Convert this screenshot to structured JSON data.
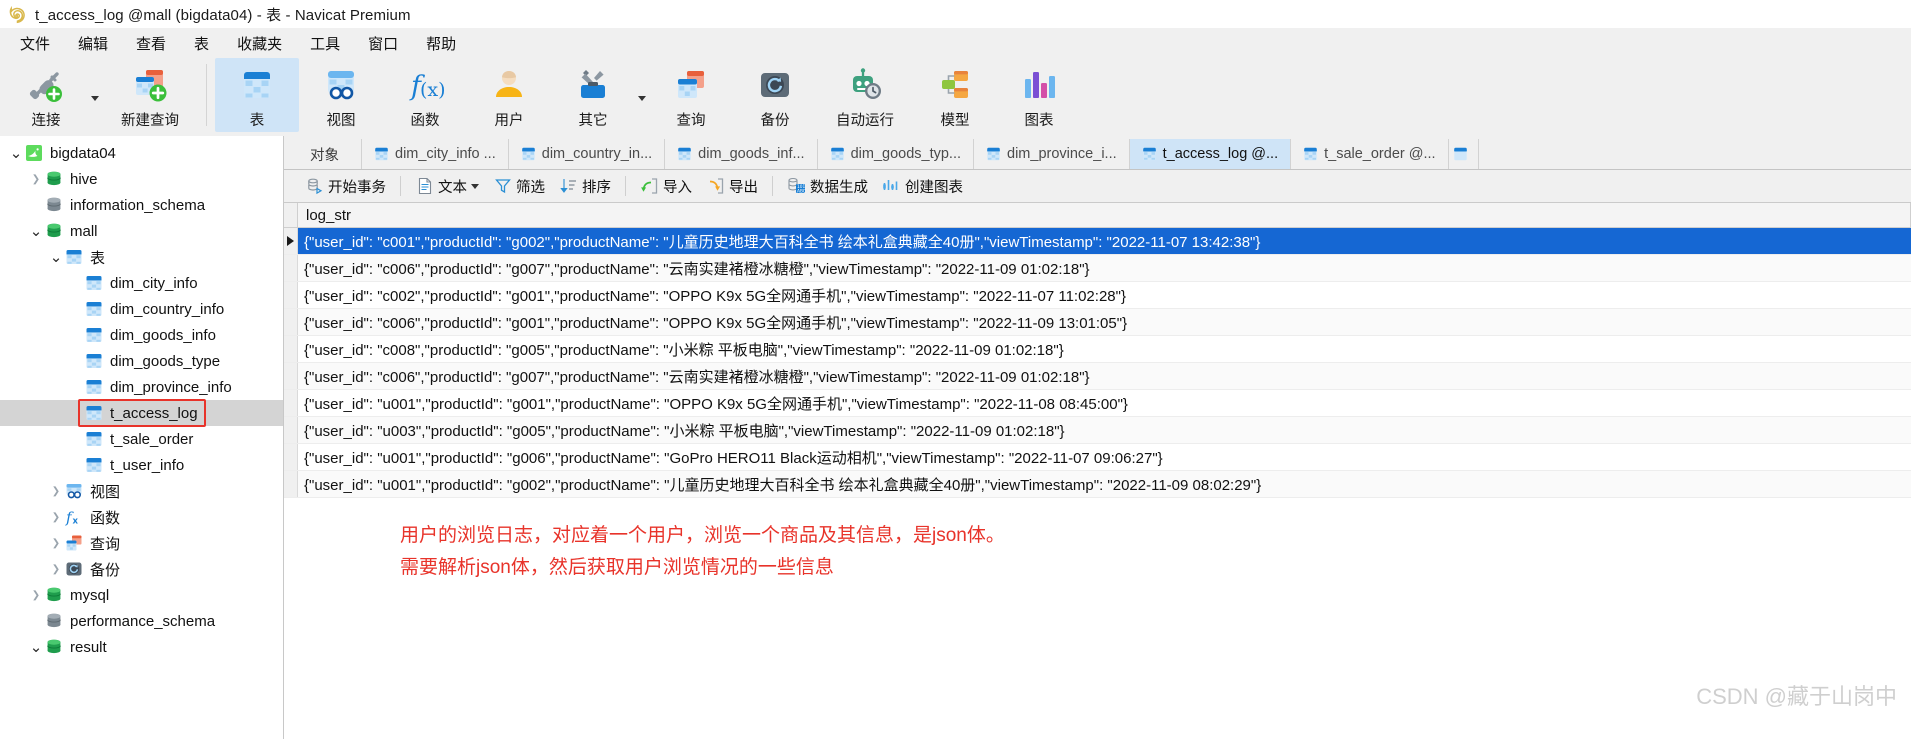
{
  "window": {
    "title": "t_access_log @mall (bigdata04) - 表 - Navicat Premium",
    "logo_icon": "navicat-logo-icon"
  },
  "menubar": {
    "items": [
      {
        "label": "文件"
      },
      {
        "label": "编辑"
      },
      {
        "label": "查看"
      },
      {
        "label": "表"
      },
      {
        "label": "收藏夹"
      },
      {
        "label": "工具"
      },
      {
        "label": "窗口"
      },
      {
        "label": "帮助"
      }
    ]
  },
  "toolbar": {
    "buttons": [
      {
        "label": "连接",
        "icon": "connection-plug-icon",
        "has_caret": true,
        "active": false
      },
      {
        "label": "新建查询",
        "icon": "new-query-icon",
        "has_caret": false,
        "active": false
      },
      {
        "label": "表",
        "icon": "table-icon",
        "has_caret": false,
        "active": true
      },
      {
        "label": "视图",
        "icon": "view-goggles-icon",
        "has_caret": false,
        "active": false
      },
      {
        "label": "函数",
        "icon": "function-fx-icon",
        "has_caret": false,
        "active": false
      },
      {
        "label": "用户",
        "icon": "user-icon",
        "has_caret": false,
        "active": false
      },
      {
        "label": "其它",
        "icon": "other-tools-icon",
        "has_caret": true,
        "active": false
      },
      {
        "label": "查询",
        "icon": "query-icon",
        "has_caret": false,
        "active": false
      },
      {
        "label": "备份",
        "icon": "backup-icon",
        "has_caret": false,
        "active": false
      },
      {
        "label": "自动运行",
        "icon": "automation-robot-icon",
        "has_caret": false,
        "active": false
      },
      {
        "label": "模型",
        "icon": "model-icon",
        "has_caret": false,
        "active": false
      },
      {
        "label": "图表",
        "icon": "chart-bars-icon",
        "has_caret": false,
        "active": false
      }
    ]
  },
  "sidebar": {
    "tree": [
      {
        "label": "bigdata04",
        "icon": "mysql-server-icon",
        "indent": 0,
        "twisty": "open",
        "selected": false,
        "boxed": false
      },
      {
        "label": "hive",
        "icon": "database-green-icon",
        "indent": 1,
        "twisty": "closed",
        "selected": false,
        "boxed": false
      },
      {
        "label": "information_schema",
        "icon": "database-gray-icon",
        "indent": 1,
        "twisty": "none",
        "selected": false,
        "boxed": false
      },
      {
        "label": "mall",
        "icon": "database-green-icon",
        "indent": 1,
        "twisty": "open",
        "selected": false,
        "boxed": false
      },
      {
        "label": "表",
        "icon": "table-folder-icon",
        "indent": 2,
        "twisty": "open",
        "selected": false,
        "boxed": false
      },
      {
        "label": "dim_city_info",
        "icon": "table-icon",
        "indent": 3,
        "twisty": "none",
        "selected": false,
        "boxed": false
      },
      {
        "label": "dim_country_info",
        "icon": "table-icon",
        "indent": 3,
        "twisty": "none",
        "selected": false,
        "boxed": false
      },
      {
        "label": "dim_goods_info",
        "icon": "table-icon",
        "indent": 3,
        "twisty": "none",
        "selected": false,
        "boxed": false
      },
      {
        "label": "dim_goods_type",
        "icon": "table-icon",
        "indent": 3,
        "twisty": "none",
        "selected": false,
        "boxed": false
      },
      {
        "label": "dim_province_info",
        "icon": "table-icon",
        "indent": 3,
        "twisty": "none",
        "selected": false,
        "boxed": false
      },
      {
        "label": "t_access_log",
        "icon": "table-icon",
        "indent": 3,
        "twisty": "none",
        "selected": true,
        "boxed": true
      },
      {
        "label": "t_sale_order",
        "icon": "table-icon",
        "indent": 3,
        "twisty": "none",
        "selected": false,
        "boxed": false
      },
      {
        "label": "t_user_info",
        "icon": "table-icon",
        "indent": 3,
        "twisty": "none",
        "selected": false,
        "boxed": false
      },
      {
        "label": "视图",
        "icon": "view-goggles-icon",
        "indent": 2,
        "twisty": "closed",
        "selected": false,
        "boxed": false
      },
      {
        "label": "函数",
        "icon": "function-fx-icon",
        "indent": 2,
        "twisty": "closed",
        "selected": false,
        "boxed": false
      },
      {
        "label": "查询",
        "icon": "query-icon",
        "indent": 2,
        "twisty": "closed",
        "selected": false,
        "boxed": false
      },
      {
        "label": "备份",
        "icon": "backup-icon",
        "indent": 2,
        "twisty": "closed",
        "selected": false,
        "boxed": false
      },
      {
        "label": "mysql",
        "icon": "database-green-icon",
        "indent": 1,
        "twisty": "closed",
        "selected": false,
        "boxed": false
      },
      {
        "label": "performance_schema",
        "icon": "database-gray-icon",
        "indent": 1,
        "twisty": "none",
        "selected": false,
        "boxed": false
      },
      {
        "label": "result",
        "icon": "database-green-icon",
        "indent": 1,
        "twisty": "open",
        "selected": false,
        "boxed": false
      }
    ]
  },
  "tabs": {
    "items": [
      {
        "label": "对象",
        "icon": "none",
        "active": false
      },
      {
        "label": "dim_city_info ...",
        "icon": "table-icon",
        "active": false
      },
      {
        "label": "dim_country_in...",
        "icon": "table-icon",
        "active": false
      },
      {
        "label": "dim_goods_inf...",
        "icon": "table-icon",
        "active": false
      },
      {
        "label": "dim_goods_typ...",
        "icon": "table-icon",
        "active": false
      },
      {
        "label": "dim_province_i...",
        "icon": "table-icon",
        "active": false
      },
      {
        "label": "t_access_log @...",
        "icon": "table-icon",
        "active": true
      },
      {
        "label": "t_sale_order @...",
        "icon": "table-icon",
        "active": false
      }
    ]
  },
  "gridbar": {
    "buttons": [
      {
        "label": "开始事务",
        "icon": "begin-transaction-icon",
        "caret": false
      },
      {
        "label": "文本",
        "icon": "text-document-icon",
        "caret": true
      },
      {
        "label": "筛选",
        "icon": "filter-funnel-icon",
        "caret": false
      },
      {
        "label": "排序",
        "icon": "sort-icon",
        "caret": false
      },
      {
        "label": "导入",
        "icon": "import-icon",
        "caret": false
      },
      {
        "label": "导出",
        "icon": "export-icon",
        "caret": false
      },
      {
        "label": "数据生成",
        "icon": "data-generation-icon",
        "caret": false
      },
      {
        "label": "创建图表",
        "icon": "create-chart-icon",
        "caret": false
      }
    ],
    "separators_after": [
      0,
      3,
      5
    ]
  },
  "grid": {
    "columns": [
      "log_str"
    ],
    "selected_row_index": 0,
    "rows": [
      {
        "log_str": "{\"user_id\": \"c001\",\"productId\": \"g002\",\"productName\": \"儿童历史地理大百科全书 绘本礼盒典藏全40册\",\"viewTimestamp\": \"2022-11-07 13:42:38\"}"
      },
      {
        "log_str": "{\"user_id\": \"c006\",\"productId\": \"g007\",\"productName\": \"云南实建褚橙冰糖橙\",\"viewTimestamp\": \"2022-11-09 01:02:18\"}"
      },
      {
        "log_str": "{\"user_id\": \"c002\",\"productId\": \"g001\",\"productName\": \"OPPO K9x 5G全网通手机\",\"viewTimestamp\": \"2022-11-07 11:02:28\"}"
      },
      {
        "log_str": "{\"user_id\": \"c006\",\"productId\": \"g001\",\"productName\": \"OPPO K9x 5G全网通手机\",\"viewTimestamp\": \"2022-11-09 13:01:05\"}"
      },
      {
        "log_str": "{\"user_id\": \"c008\",\"productId\": \"g005\",\"productName\": \"小米粽 平板电脑\",\"viewTimestamp\": \"2022-11-09 01:02:18\"}"
      },
      {
        "log_str": "{\"user_id\": \"c006\",\"productId\": \"g007\",\"productName\": \"云南实建褚橙冰糖橙\",\"viewTimestamp\": \"2022-11-09 01:02:18\"}"
      },
      {
        "log_str": "{\"user_id\": \"u001\",\"productId\": \"g001\",\"productName\": \"OPPO K9x 5G全网通手机\",\"viewTimestamp\": \"2022-11-08 08:45:00\"}"
      },
      {
        "log_str": "{\"user_id\": \"u003\",\"productId\": \"g005\",\"productName\": \"小米粽 平板电脑\",\"viewTimestamp\": \"2022-11-09 01:02:18\"}"
      },
      {
        "log_str": "{\"user_id\": \"u001\",\"productId\": \"g006\",\"productName\": \"GoPro HERO11 Black运动相机\",\"viewTimestamp\": \"2022-11-07 09:06:27\"}"
      },
      {
        "log_str": "{\"user_id\": \"u001\",\"productId\": \"g002\",\"productName\": \"儿童历史地理大百科全书 绘本礼盒典藏全40册\",\"viewTimestamp\": \"2022-11-09 08:02:29\"}"
      }
    ]
  },
  "annotations": {
    "line1": "用户的浏览日志，对应着一个用户，浏览一个商品及其信息，是json体。",
    "line2": "需要解析json体，然后获取用户浏览情况的一些信息",
    "color": "#e8332a"
  },
  "watermark": {
    "text": "CSDN @藏于山岗中"
  }
}
